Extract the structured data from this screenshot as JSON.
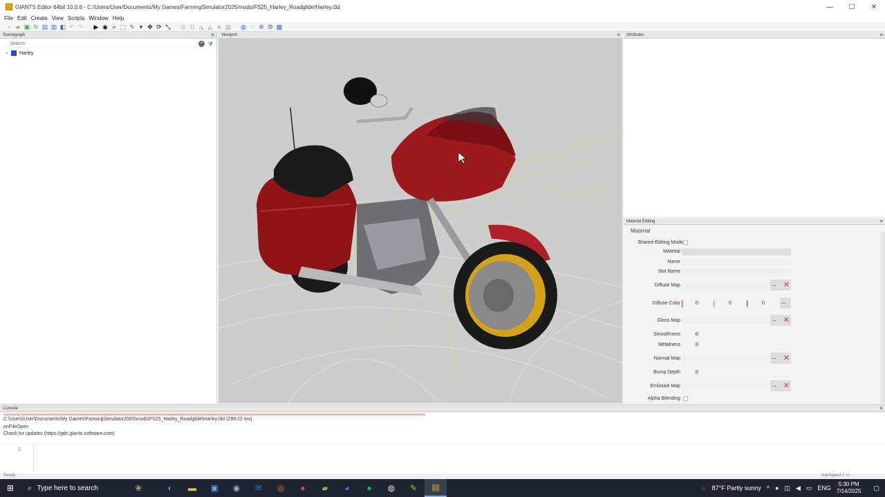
{
  "window": {
    "title": "GIANTS Editor 64bit 10.0.6 - C:/Users/User/Documents/My Games/FarmingSimulator2025/mods/FS25_Harley_Roadglide/Harley.i3d",
    "minimize": "—",
    "maximize": "☐",
    "close": "✕"
  },
  "menu": [
    "File",
    "Edit",
    "Create",
    "View",
    "Scripts",
    "Window",
    "Help"
  ],
  "panels": {
    "scenegraph": "Scenegraph",
    "viewport": "Viewport",
    "attributes": "Attributes",
    "material_editing": "Material Editing",
    "console": "Console"
  },
  "scenegraph": {
    "search_placeholder": "Search",
    "root_node": "Harley"
  },
  "material": {
    "section": "Material",
    "shared_editing_mode": "Shared-Editing Mode",
    "material_label": "Material",
    "name_label": "Name",
    "slot_name_label": "Slot Name",
    "diffuse_map_label": "Diffuse Map",
    "diffuse_color_label": "Diffuse Color",
    "diffuse_r": "0",
    "diffuse_g": "0",
    "diffuse_b": "0",
    "gloss_map_label": "Gloss Map",
    "smoothness_label": "Smoothness",
    "smoothness": "0",
    "metalness_label": "Metalness",
    "metalness": "0",
    "normal_map_label": "Normal Map",
    "bump_depth_label": "Bump Depth",
    "bump_depth": "0",
    "emissive_map_label": "Emissive Map",
    "alpha_blending_label": "Alpha Blending",
    "map_button_dots": "...",
    "map_button_x": "✕"
  },
  "console": {
    "lines": [
      "C:\\Users\\User\\Documents\\My Games\\FarmingSimulator2025\\mods\\FS25_Harley_Roadglide\\Harley.i3d (293.22 ms)",
      "onFileOpen",
      "Check for updates (https://gdn.giants-software.com)"
    ],
    "line_number": "1"
  },
  "status": {
    "left": "Ready",
    "right": "NavSpeed 1 +/-"
  },
  "taskbar": {
    "search": "Type here to search",
    "weather": "87°F  Partly sunny",
    "language": "ENG",
    "time": "5:30 PM",
    "date": "7/14/2025"
  },
  "colors": {
    "bike_red": "#9c1a1e",
    "rim_gold": "#d4a21a",
    "wire_yellow": "#e8e25a"
  }
}
